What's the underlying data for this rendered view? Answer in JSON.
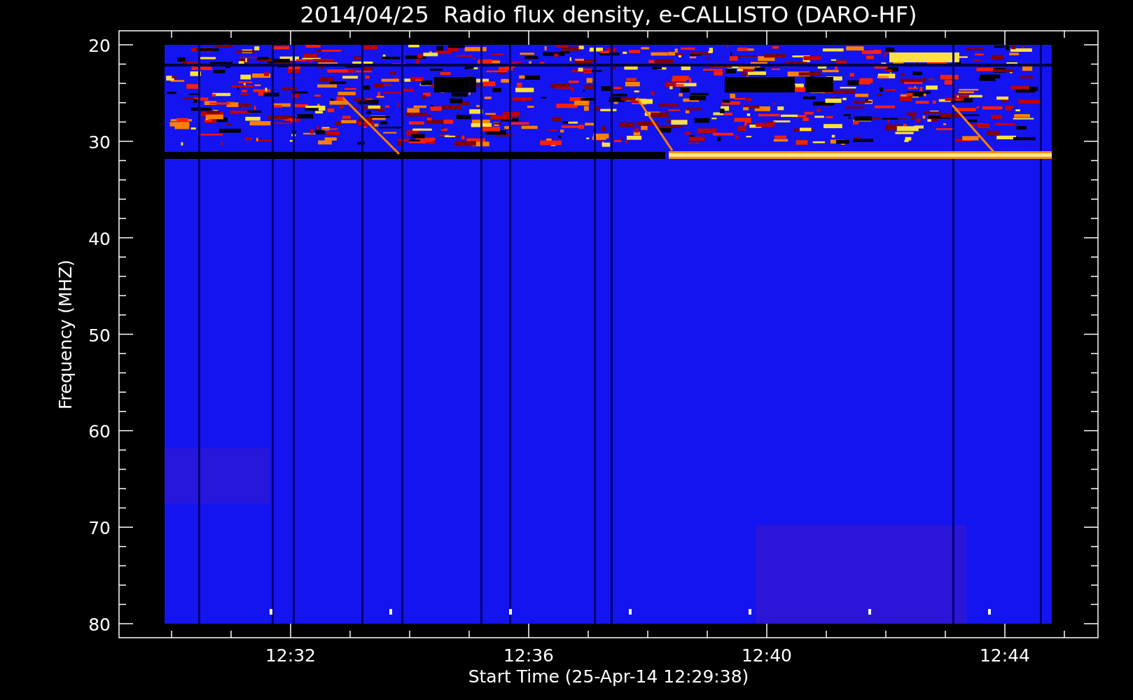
{
  "title": "2014/04/25  Radio flux density, e-CALLISTO (DARO-HF)",
  "y_axis": {
    "label": "Frequency (MHZ)",
    "ticks": [
      "20",
      "30",
      "40",
      "50",
      "60",
      "70",
      "80"
    ]
  },
  "x_axis": {
    "label": "Start Time (25-Apr-14 12:29:38)",
    "ticks": [
      "12:32",
      "12:36",
      "12:40",
      "12:44"
    ]
  }
}
